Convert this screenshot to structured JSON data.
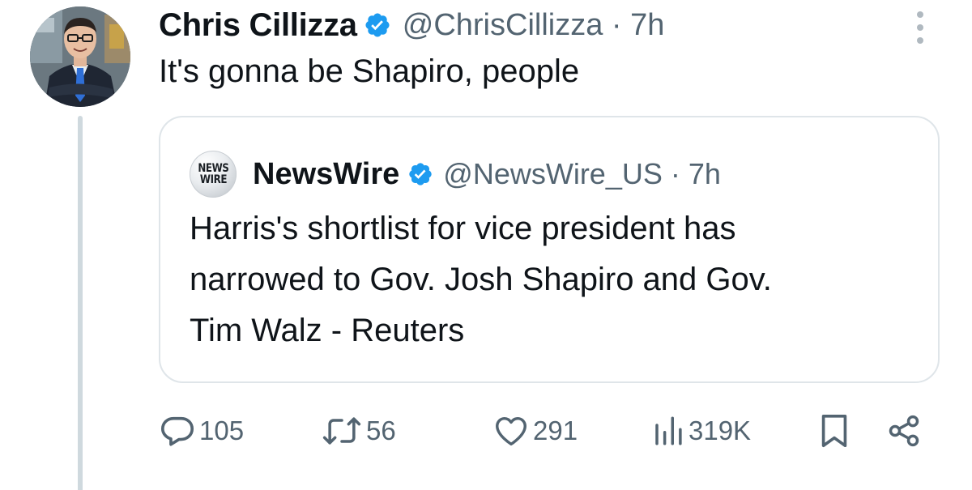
{
  "tweet": {
    "author_name": "Chris Cillizza",
    "handle_time": "@ChrisCillizza · 7h",
    "text": "It's gonna be Shapiro, people"
  },
  "quote": {
    "avatar_line1": "NEWS",
    "avatar_line2": "WIRE",
    "author_name": "NewsWire",
    "handle_time": "@NewsWire_US · 7h",
    "text_lines": [
      "Harris's shortlist for vice president has",
      "narrowed to Gov. Josh Shapiro and Gov.",
      "Tim Walz - Reuters"
    ]
  },
  "actions": {
    "replies": "105",
    "reposts": "56",
    "likes": "291",
    "views": "319K"
  },
  "colors": {
    "verified": "#1d9bf0",
    "muted_text": "#536471",
    "primary_text": "#0f1419",
    "thread_line": "#cfd9de"
  },
  "icons": [
    "verified-badge-icon",
    "more-options-icon",
    "reply-icon",
    "repost-icon",
    "like-icon",
    "views-icon",
    "bookmark-icon",
    "share-icon"
  ]
}
